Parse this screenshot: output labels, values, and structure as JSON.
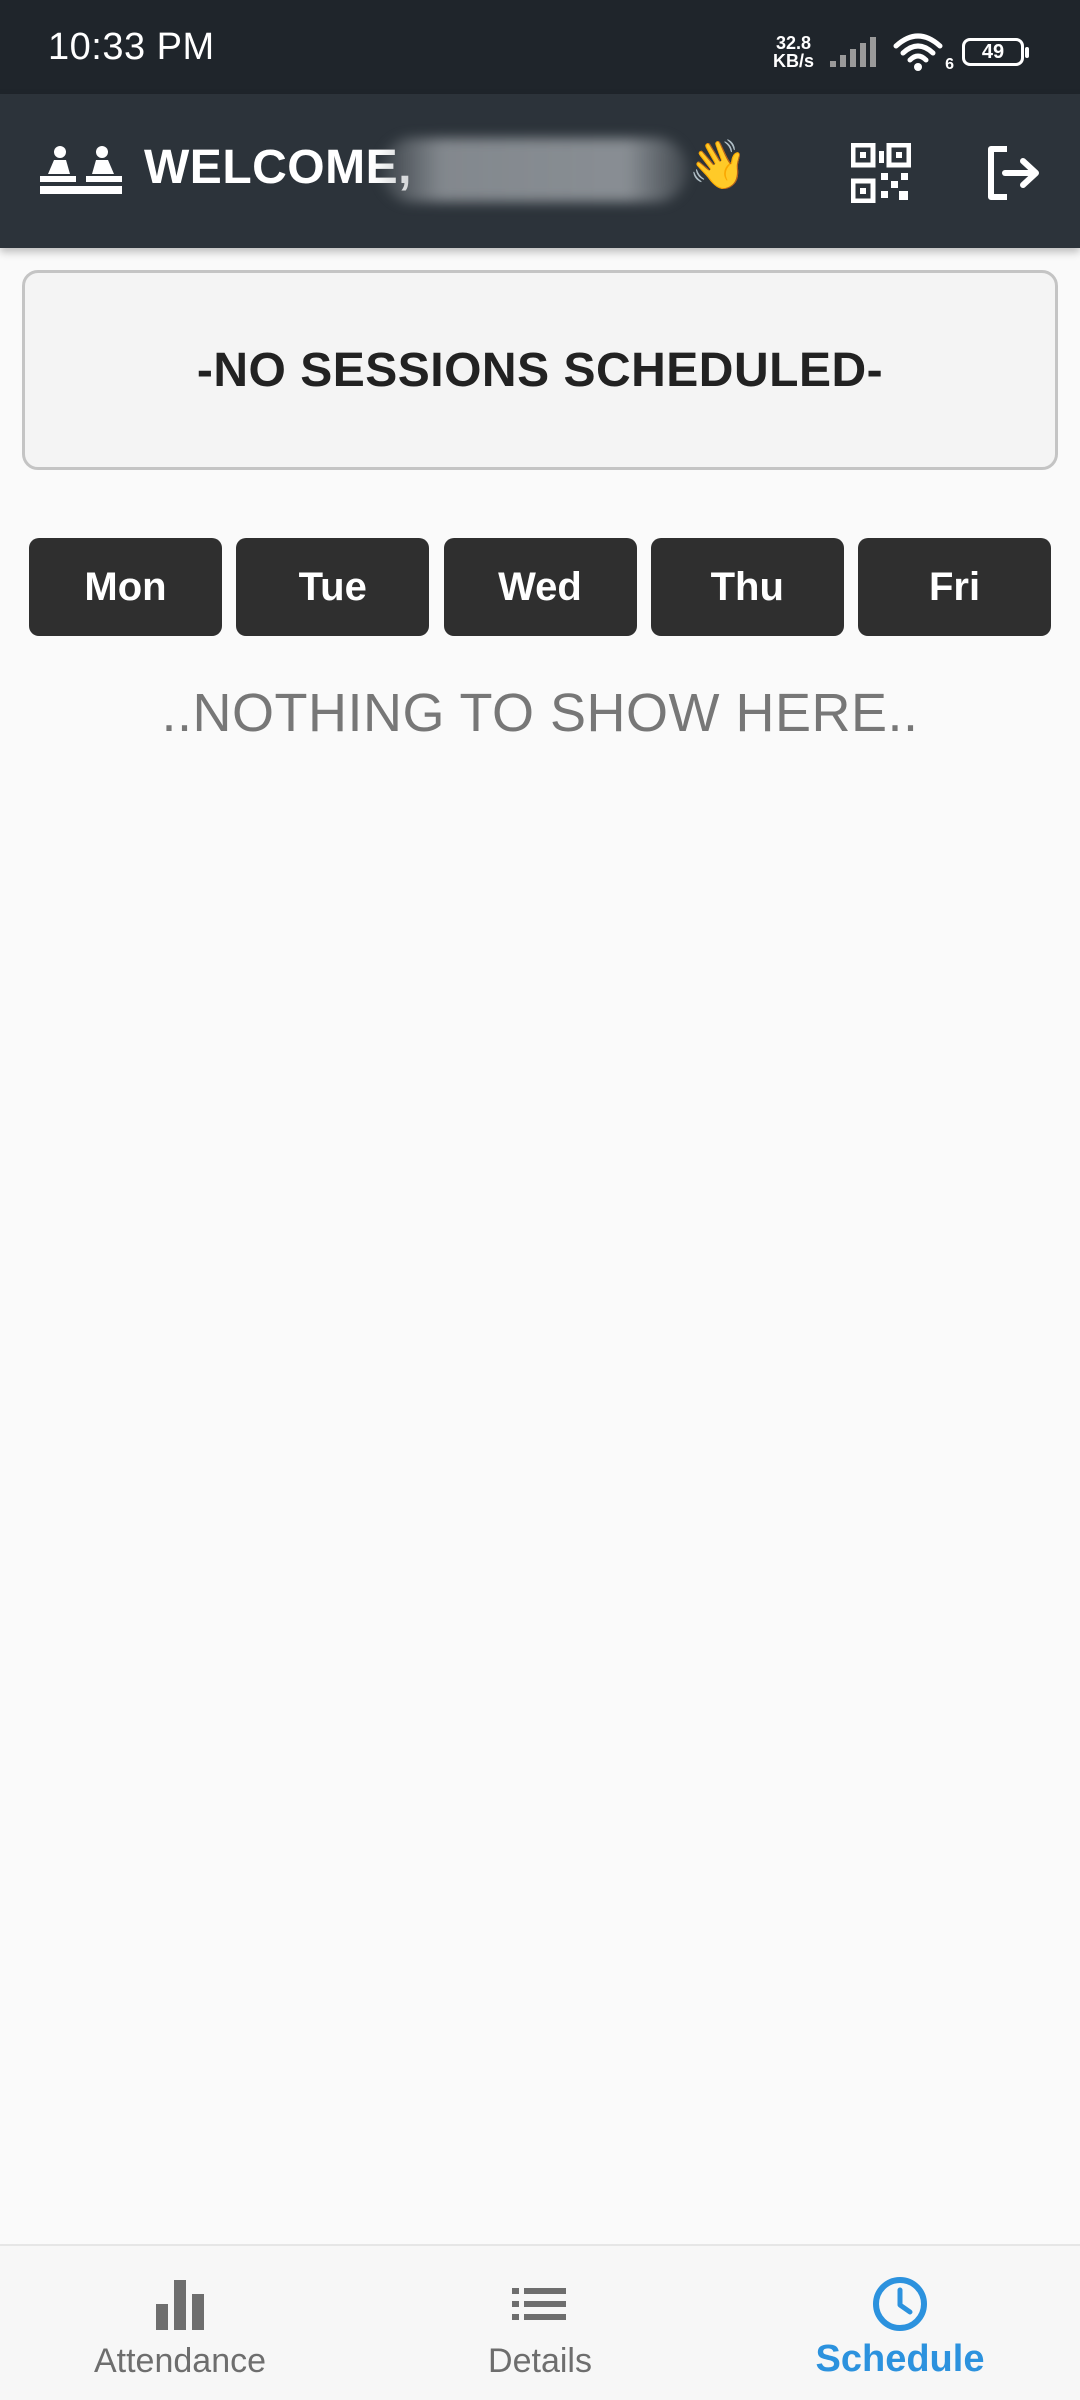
{
  "status_bar": {
    "time": "10:33 PM",
    "net_speed_value": "32.8",
    "net_speed_unit": "KB/s",
    "wifi_badge": "6",
    "battery_level": "49"
  },
  "header": {
    "welcome_text": "WELCOME,",
    "wave_emoji": "👋",
    "icons": {
      "logo": "classroom-icon",
      "qr": "qr-code-icon",
      "logout": "logout-icon"
    }
  },
  "sessions": {
    "message": "-NO SESSIONS SCHEDULED-"
  },
  "days": [
    {
      "label": "Mon"
    },
    {
      "label": "Tue"
    },
    {
      "label": "Wed"
    },
    {
      "label": "Thu"
    },
    {
      "label": "Fri"
    }
  ],
  "empty_state": {
    "message": "..NOTHING TO SHOW HERE.."
  },
  "bottom_nav": {
    "items": [
      {
        "label": "Attendance",
        "icon": "bar-chart-icon",
        "active": false
      },
      {
        "label": "Details",
        "icon": "list-icon",
        "active": false
      },
      {
        "label": "Schedule",
        "icon": "clock-icon",
        "active": true
      }
    ],
    "active_color": "#2c92de",
    "inactive_color": "#6e6e6e"
  },
  "colors": {
    "status_bar_bg": "#1f252b",
    "header_bg": "#2c333a",
    "day_button_bg": "#2f2f2f",
    "page_bg": "#fafafa"
  }
}
